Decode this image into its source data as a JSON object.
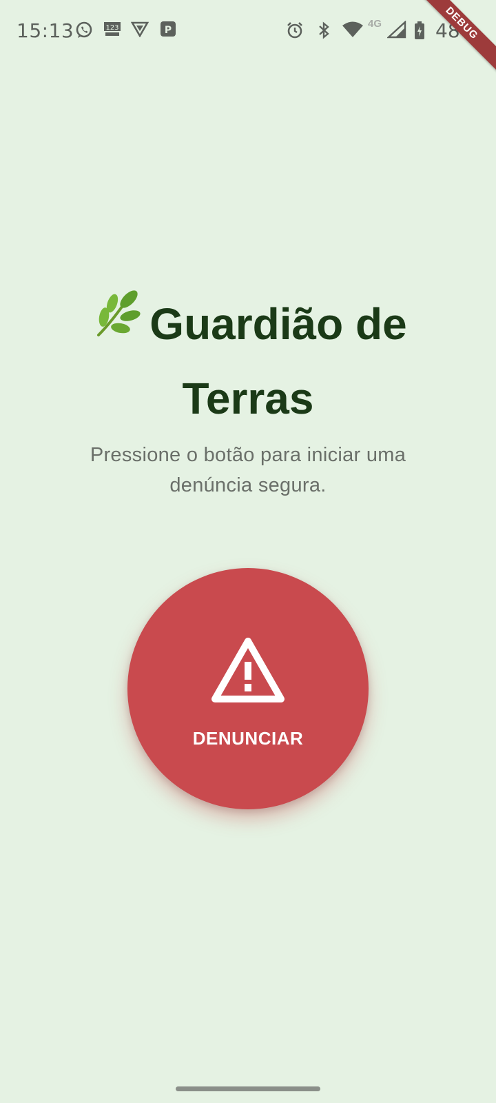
{
  "status_bar": {
    "time": "15:13",
    "battery_percent": "48",
    "network_label": "4G",
    "icons": [
      "whatsapp-icon",
      "days-counter-icon",
      "vpn-shield-icon",
      "parking-app-icon",
      "alarm-icon",
      "bluetooth-icon",
      "wifi-icon",
      "signal-icon",
      "battery-charging-icon"
    ]
  },
  "debug_banner": "DEBUG",
  "app": {
    "title_icon": "herb-icon",
    "title": "Guardião de Terras",
    "subtitle": "Pressione o botão para iniciar uma denúncia segura."
  },
  "report_button": {
    "label": "DENUNCIAR",
    "icon": "warning-icon"
  },
  "colors": {
    "background": "#e5f2e3",
    "title": "#1b3a17",
    "subtitle": "#6a6f69",
    "button": "#c94a4e",
    "button_text": "#ffffff"
  }
}
